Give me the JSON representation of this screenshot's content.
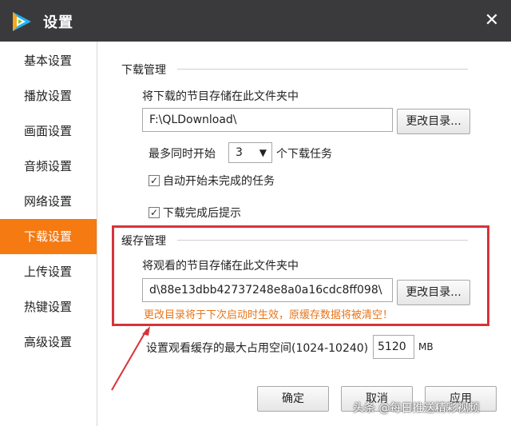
{
  "window": {
    "title": "设置"
  },
  "sidebar": {
    "items": [
      {
        "label": "基本设置"
      },
      {
        "label": "播放设置"
      },
      {
        "label": "画面设置"
      },
      {
        "label": "音频设置"
      },
      {
        "label": "网络设置"
      },
      {
        "label": "下载设置",
        "active": true
      },
      {
        "label": "上传设置"
      },
      {
        "label": "热键设置"
      },
      {
        "label": "高级设置"
      }
    ]
  },
  "download": {
    "section_title": "下载管理",
    "folder_label": "将下载的节目存储在此文件夹中",
    "folder_value": "F:\\QLDownload\\",
    "change_dir_label": "更改目录...",
    "max_tasks_prefix": "最多同时开始",
    "max_tasks_value": "3",
    "max_tasks_suffix": "个下载任务",
    "auto_start_label": "自动开始未完成的任务",
    "notify_label": "下载完成后提示"
  },
  "cache": {
    "section_title": "缓存管理",
    "folder_label": "将观看的节目存储在此文件夹中",
    "folder_value": "d\\88e13dbb42737248e8a0a16cdc8ff098\\",
    "change_dir_label": "更改目录...",
    "warning": "更改目录将于下次启动时生效，原缓存数据将被清空！",
    "max_space_label": "设置观看缓存的最大占用空间(1024-10240)",
    "max_space_value": "5120",
    "max_space_unit": "MB"
  },
  "footer": {
    "ok_label": "确定",
    "cancel_label": "取消",
    "apply_label": "应用"
  },
  "watermark": "头条 @每日推送精彩视频",
  "colors": {
    "accent": "#f57a12",
    "highlight": "#d9323a",
    "warning": "#e8751a",
    "titlebar": "#3a3a3d"
  }
}
